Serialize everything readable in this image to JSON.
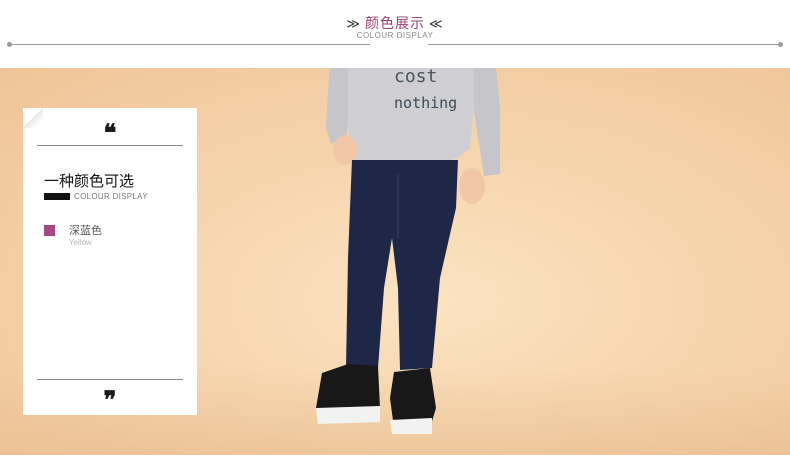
{
  "header": {
    "left_chevrons": "≫",
    "title": "颜色展示",
    "right_chevrons": "≪",
    "subtitle": "COLOUR DISPLAY"
  },
  "photo": {
    "shirt_text": "cost nothing"
  },
  "card": {
    "open_quote": "❝",
    "close_quote": "❞",
    "title": "一种颜色可选",
    "subtitle": "COLOUR DISPLAY",
    "color_name": "深蓝色",
    "color_name_en": "Yellow",
    "swatch_color": "#a64786"
  },
  "colors": {
    "accent": "#9b3f77",
    "jeans": "#1f2747",
    "shirt": "#c9c9cc"
  }
}
